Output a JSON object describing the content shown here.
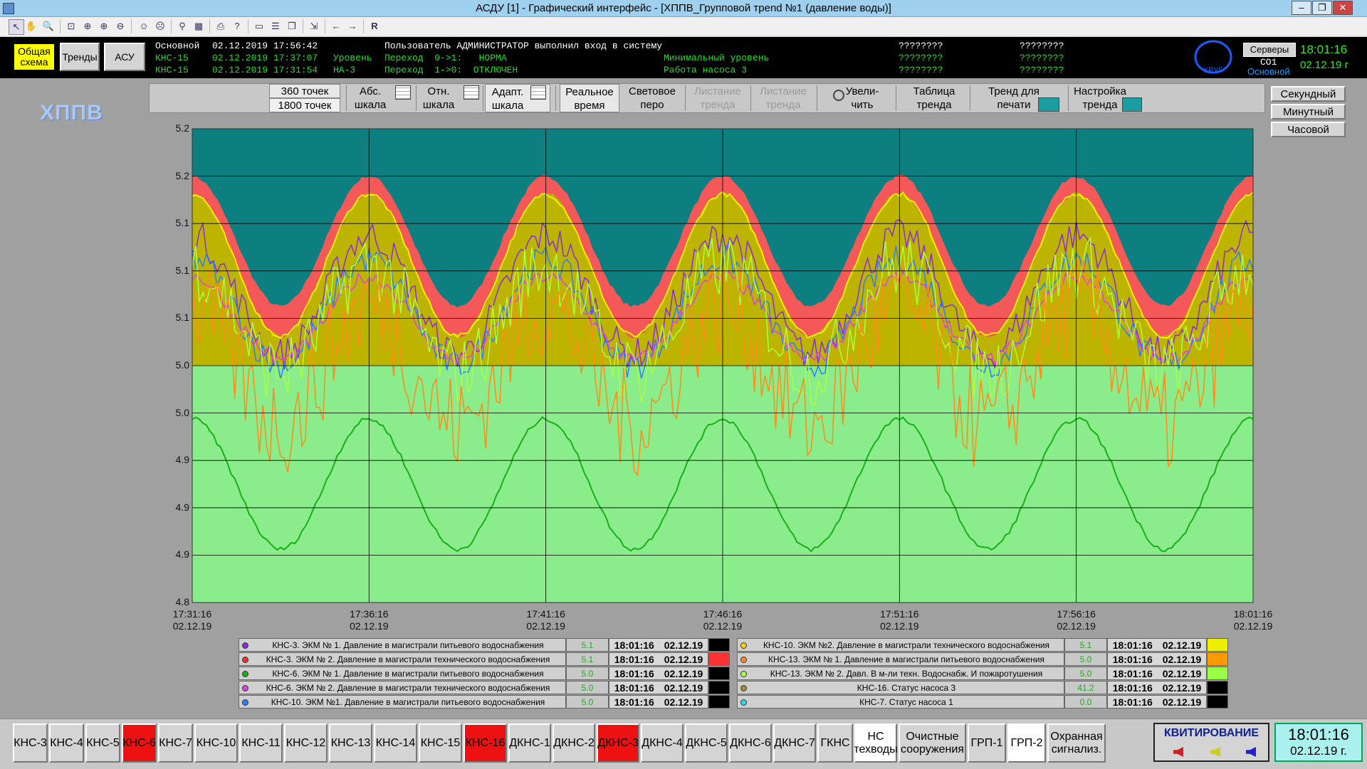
{
  "window": {
    "title": "АСДУ [1] - Графический интерфейс - [ХППВ_Групповой трend №1 (давление воды)]",
    "controls": {
      "minimize": "–",
      "restore": "❐",
      "close": "✕"
    }
  },
  "toolbar": {
    "last_item": "R"
  },
  "nav_buttons": [
    "Общая схема",
    "Тренды",
    "АСУ"
  ],
  "status": {
    "rows": [
      {
        "col1": "Основной",
        "col2": "02.12.2019 17:56:42",
        "col3": "",
        "col4": "Пользователь АДМИНИСТРАТОР выполнил вход в систему",
        "col5": "",
        "col6": "????????",
        "col7": "????????"
      },
      {
        "col1": "КНС-15",
        "col2": "02.12.2019 17:37:07",
        "col3": "Уровень",
        "col4": "Переход  0->1:   НОРМА",
        "col5": "Минимальный уровень",
        "col6": "????????",
        "col7": "????????"
      },
      {
        "col1": "КНС-15",
        "col2": "02.12.2019 17:31:54",
        "col3": "НА-3",
        "col4": "Переход  1->0:  ОТКЛЮЧЕН",
        "col5": "Работа насоса 3",
        "col6": "????????",
        "col7": "????????"
      }
    ],
    "krug_logo": "КРУГ",
    "servers": {
      "button": "Серверы",
      "name": "СО1",
      "mode": "Основной"
    },
    "time": "18:01:16",
    "date": "02.12.19 г"
  },
  "logo": "ХППВ",
  "controls": {
    "points_360": "360 точек",
    "points_1800": "1800 точек",
    "abs_scale": [
      "Абс.",
      "шкала"
    ],
    "rel_scale": [
      "Отн.",
      "шкала"
    ],
    "adapt_scale": [
      "Адапт.",
      "шкала"
    ],
    "real_time": [
      "Реальное",
      "время"
    ],
    "light_pen": [
      "Световое",
      "перо"
    ],
    "scroll_back": [
      "Листание",
      "тренда"
    ],
    "scroll_fwd": [
      "Листание",
      "тренда"
    ],
    "zoom": [
      "Увели-",
      "чить"
    ],
    "table": [
      "Таблица",
      "тренда"
    ],
    "print": [
      "Тренд для",
      "печати"
    ],
    "settings": [
      "Настройка",
      "тренда"
    ],
    "right": [
      "Секундный",
      "Минутный",
      "Часовой"
    ]
  },
  "chart_data": {
    "type": "line",
    "background_colors": {
      "plot": "#0d7f80",
      "fill_red": "#f45858",
      "fill_olive": "#bdb400",
      "fill_yellow_line": "#f0f000",
      "fill_green": "#8aec8a",
      "dark_green_line": "#18b018"
    },
    "y_tick_labels": [
      "5.2",
      "5.2",
      "5.1",
      "5.1",
      "5.1",
      "5.0",
      "5.0",
      "4.9",
      "4.9",
      "4.9",
      "4.8"
    ],
    "ylim": [
      4.8,
      5.2
    ],
    "x_tick_labels": [
      {
        "time": "17:31:16",
        "date": "02.12.19"
      },
      {
        "time": "17:36:16",
        "date": "02.12.19"
      },
      {
        "time": "17:41:16",
        "date": "02.12.19"
      },
      {
        "time": "17:46:16",
        "date": "02.12.19"
      },
      {
        "time": "17:51:16",
        "date": "02.12.19"
      },
      {
        "time": "17:56:16",
        "date": "02.12.19"
      },
      {
        "time": "18:01:16",
        "date": "02.12.19"
      }
    ],
    "grid": true,
    "period_minutes": 5,
    "series_colors": [
      "#8a2be2",
      "#ff3030",
      "#18b018",
      "#e040e0",
      "#2a7fff",
      "#ffb000",
      "#ff8c1a",
      "#aaff44"
    ]
  },
  "legend": {
    "left": [
      {
        "color": "#8a2be2",
        "name": "КНС-3. ЭКМ № 1. Давление в магистрали питьевого водоснабжения",
        "value": "5.1",
        "time": "18:01:16",
        "date": "02.12.19",
        "swatch": "#000"
      },
      {
        "color": "#ff3030",
        "name": "КНС-3. ЭКМ № 2. Давление в магистрали технического водоснабжения",
        "value": "5.1",
        "time": "18:01:16",
        "date": "02.12.19",
        "swatch": "#f33"
      },
      {
        "color": "#18b018",
        "name": "КНС-6. ЭКМ № 1. Давление в магистрали питьевого водоснабжения",
        "value": "5.0",
        "time": "18:01:16",
        "date": "02.12.19",
        "swatch": "#000"
      },
      {
        "color": "#e040e0",
        "name": "КНС-6. ЭКМ № 2. Давление в магистрали технического водоснабжения",
        "value": "5.0",
        "time": "18:01:16",
        "date": "02.12.19",
        "swatch": "#000"
      },
      {
        "color": "#2a7fff",
        "name": "КНС-10. ЭКМ №1. Давление в магистрали питьевого водоснабжения",
        "value": "5.0",
        "time": "18:01:16",
        "date": "02.12.19",
        "swatch": "#000"
      }
    ],
    "right": [
      {
        "color": "#ffd000",
        "name": "КНС-10. ЭКМ №2. Давление в магистрали технического водоснабжения",
        "value": "5.1",
        "time": "18:01:16",
        "date": "02.12.19",
        "swatch": "#ee0"
      },
      {
        "color": "#ff8c1a",
        "name": "КНС-13. ЭКМ № 1. Давление в магистрали питьевого водоснабжения",
        "value": "5.0",
        "time": "18:01:16",
        "date": "02.12.19",
        "swatch": "#f90"
      },
      {
        "color": "#aaff44",
        "name": "КНС-13. ЭКМ № 2. Давл. В м-ли техн. Водоснабж. И пожаротушения",
        "value": "5.0",
        "time": "18:01:16",
        "date": "02.12.19",
        "swatch": "#9f4"
      },
      {
        "color": "#a09030",
        "name": "КНС-16. Статус насоса 3",
        "value": "41.2",
        "time": "18:01:16",
        "date": "02.12.19",
        "swatch": "#000"
      },
      {
        "color": "#30d8e8",
        "name": "КНС-7. Статус насоса 1",
        "value": "0.0",
        "time": "18:01:16",
        "date": "02.12.19",
        "swatch": "#000"
      }
    ]
  },
  "bottom_buttons": [
    {
      "label": "КНС-3",
      "state": "normal"
    },
    {
      "label": "КНС-4",
      "state": "normal"
    },
    {
      "label": "КНС-5",
      "state": "normal"
    },
    {
      "label": "КНС-6",
      "state": "alarm"
    },
    {
      "label": "КНС-7",
      "state": "normal"
    },
    {
      "label": "КНС-10",
      "state": "normal"
    },
    {
      "label": "КНС-11",
      "state": "normal"
    },
    {
      "label": "КНС-12",
      "state": "normal"
    },
    {
      "label": "КНС-13",
      "state": "normal"
    },
    {
      "label": "КНС-14",
      "state": "normal"
    },
    {
      "label": "КНС-15",
      "state": "normal"
    },
    {
      "label": "КНС-16",
      "state": "alarm"
    },
    {
      "label": "ДКНС-1",
      "state": "normal"
    },
    {
      "label": "ДКНС-2",
      "state": "normal"
    },
    {
      "label": "ДКНС-3",
      "state": "alarm"
    },
    {
      "label": "ДКНС-4",
      "state": "normal"
    },
    {
      "label": "ДКНС-5",
      "state": "normal"
    },
    {
      "label": "ДКНС-6",
      "state": "normal"
    },
    {
      "label": "ДКНС-7",
      "state": "normal"
    },
    {
      "label": "ГКНС",
      "state": "normal"
    },
    {
      "label": "НС техводы",
      "state": "white"
    },
    {
      "label": "Очистные сооружения",
      "state": "normal"
    },
    {
      "label": "ГРП-1",
      "state": "normal"
    },
    {
      "label": "ГРП-2",
      "state": "white"
    },
    {
      "label": "Охранная сигнализ.",
      "state": "normal"
    }
  ],
  "kvit": {
    "label": "КВИТИРОВАНИЕ"
  },
  "clock": {
    "time": "18:01:16",
    "date": "02.12.19 г."
  }
}
